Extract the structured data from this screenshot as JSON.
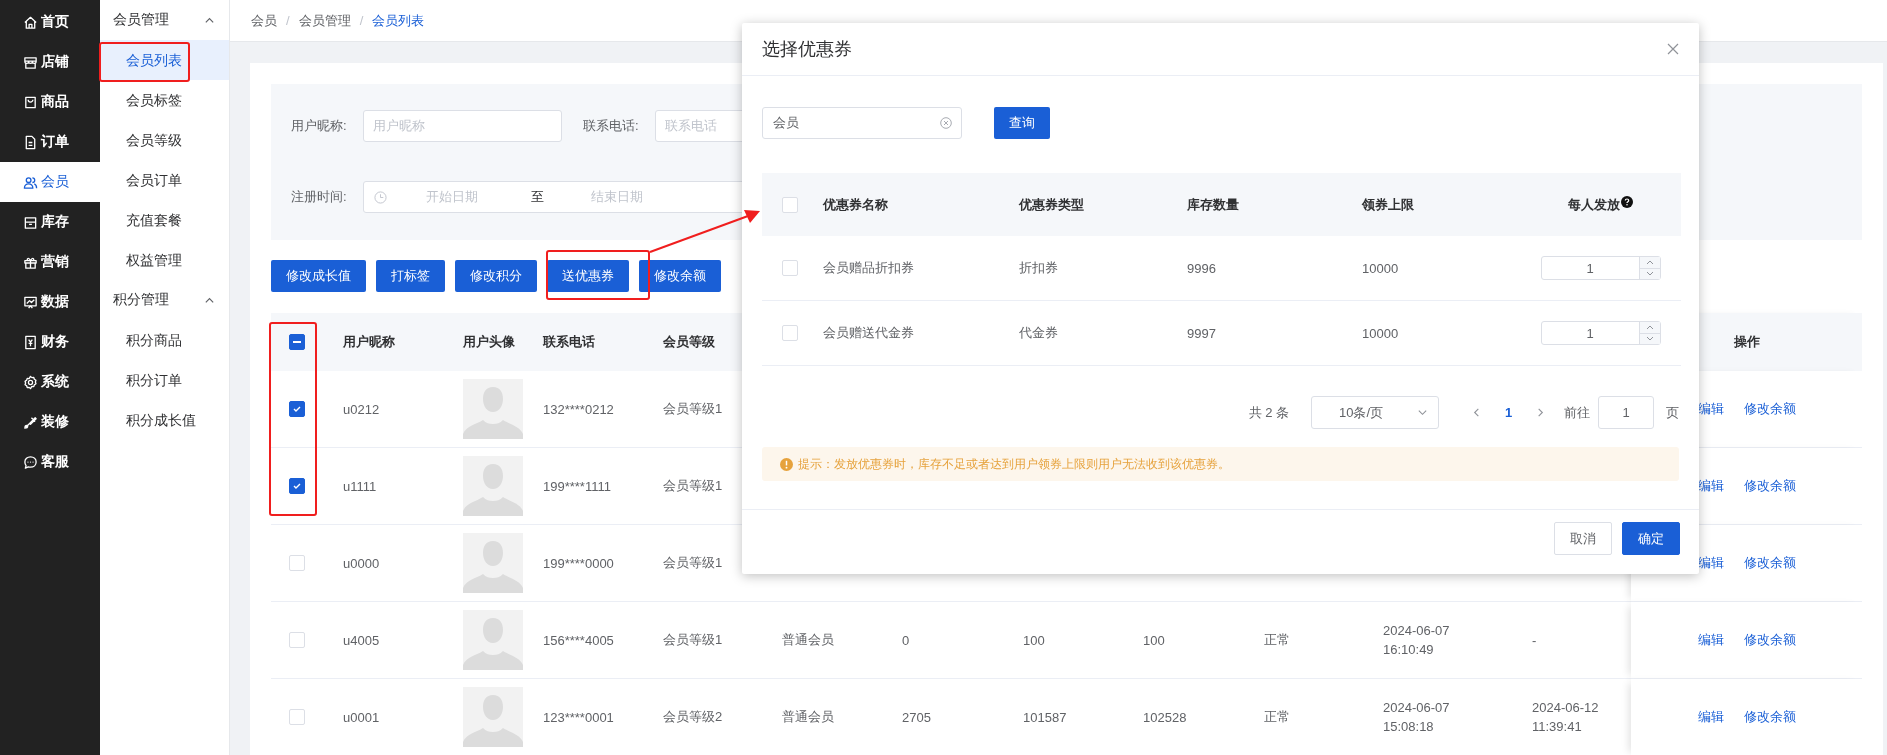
{
  "sidebar": {
    "items": [
      {
        "label": "首页",
        "selected": false
      },
      {
        "label": "店铺",
        "selected": false
      },
      {
        "label": "商品",
        "selected": false
      },
      {
        "label": "订单",
        "selected": false
      },
      {
        "label": "会员",
        "selected": true
      },
      {
        "label": "库存",
        "selected": false
      },
      {
        "label": "营销",
        "selected": false
      },
      {
        "label": "数据",
        "selected": false
      },
      {
        "label": "财务",
        "selected": false
      },
      {
        "label": "系统",
        "selected": false
      },
      {
        "label": "装修",
        "selected": false
      },
      {
        "label": "客服",
        "selected": false
      }
    ]
  },
  "submenu": {
    "groups": [
      {
        "label": "会员管理",
        "expanded": true,
        "children": [
          {
            "label": "会员列表",
            "selected": true
          },
          {
            "label": "会员标签",
            "selected": false
          },
          {
            "label": "会员等级",
            "selected": false
          },
          {
            "label": "会员订单",
            "selected": false
          },
          {
            "label": "充值套餐",
            "selected": false
          },
          {
            "label": "权益管理",
            "selected": false
          }
        ]
      },
      {
        "label": "积分管理",
        "expanded": true,
        "children": [
          {
            "label": "积分商品",
            "selected": false
          },
          {
            "label": "积分订单",
            "selected": false
          },
          {
            "label": "积分成长值",
            "selected": false
          }
        ]
      }
    ]
  },
  "breadcrumb": {
    "items": [
      "会员",
      "会员管理",
      "会员列表"
    ],
    "separator": "/"
  },
  "filters": [
    {
      "label": "用户昵称:",
      "placeholder": "用户昵称"
    },
    {
      "label": "联系电话:",
      "placeholder": "联系电话"
    }
  ],
  "date_range": {
    "label": "注册时间:",
    "start_placeholder": "开始日期",
    "separator": "至",
    "end_placeholder": "结束日期"
  },
  "actions": [
    "修改成长值",
    "打标签",
    "修改积分",
    "送优惠券",
    "修改余额"
  ],
  "table": {
    "select_all": {
      "indeterminate": true
    },
    "columns": [
      "用户昵称",
      "用户头像",
      "联系电话",
      "会员等级"
    ],
    "actions_column": "操作",
    "rows": [
      {
        "checked": true,
        "nickname": "u0212",
        "phone": "132****0212",
        "level": "会员等级1",
        "actions": [
          "编辑",
          "修改余额"
        ]
      },
      {
        "checked": true,
        "nickname": "u1111",
        "phone": "199****1111",
        "level": "会员等级1",
        "actions": [
          "编辑",
          "修改余额"
        ]
      },
      {
        "checked": false,
        "nickname": "u0000",
        "phone": "199****0000",
        "level": "会员等级1",
        "actions": [
          "编辑",
          "修改余额"
        ]
      },
      {
        "checked": false,
        "nickname": "u4005",
        "phone": "156****4005",
        "level": "会员等级1",
        "extra_cells": [
          "普通会员",
          "0",
          "100",
          "100",
          "正常",
          "2024-06-07 16:10:49",
          "-"
        ],
        "actions": [
          "编辑",
          "修改余额"
        ]
      },
      {
        "checked": false,
        "nickname": "u0001",
        "phone": "123****0001",
        "level": "会员等级2",
        "extra_cells": [
          "普通会员",
          "2705",
          "101587",
          "102528",
          "正常",
          "2024-06-07 15:08:18",
          "2024-06-12 11:39:41"
        ],
        "actions": [
          "编辑",
          "修改余额"
        ]
      }
    ]
  },
  "dialog": {
    "title": "选择优惠券",
    "search": {
      "value": "会员"
    },
    "search_button": "查询",
    "select_all": {
      "checked": false
    },
    "columns": [
      "优惠券名称",
      "优惠券类型",
      "库存数量",
      "领券上限",
      "每人发放"
    ],
    "rows": [
      {
        "checked": false,
        "name": "会员赠品折扣券",
        "type": "折扣券",
        "stock": "9996",
        "limit": "10000",
        "quantity": "1"
      },
      {
        "checked": false,
        "name": "会员赠送代金券",
        "type": "代金券",
        "stock": "9997",
        "limit": "10000",
        "quantity": "1"
      }
    ],
    "pagination": {
      "total": "共 2 条",
      "page_size": "10条/页",
      "pages": [
        {
          "label": "1",
          "selected": true
        }
      ],
      "goto_label": "前往",
      "goto_value": "1",
      "goto_suffix": "页"
    },
    "tip": "提示：发放优惠券时，库存不足或者达到用户领券上限则用户无法收到该优惠券。",
    "buttons": [
      {
        "label": "取消",
        "kind": "default"
      },
      {
        "label": "确定",
        "kind": "primary"
      }
    ]
  }
}
